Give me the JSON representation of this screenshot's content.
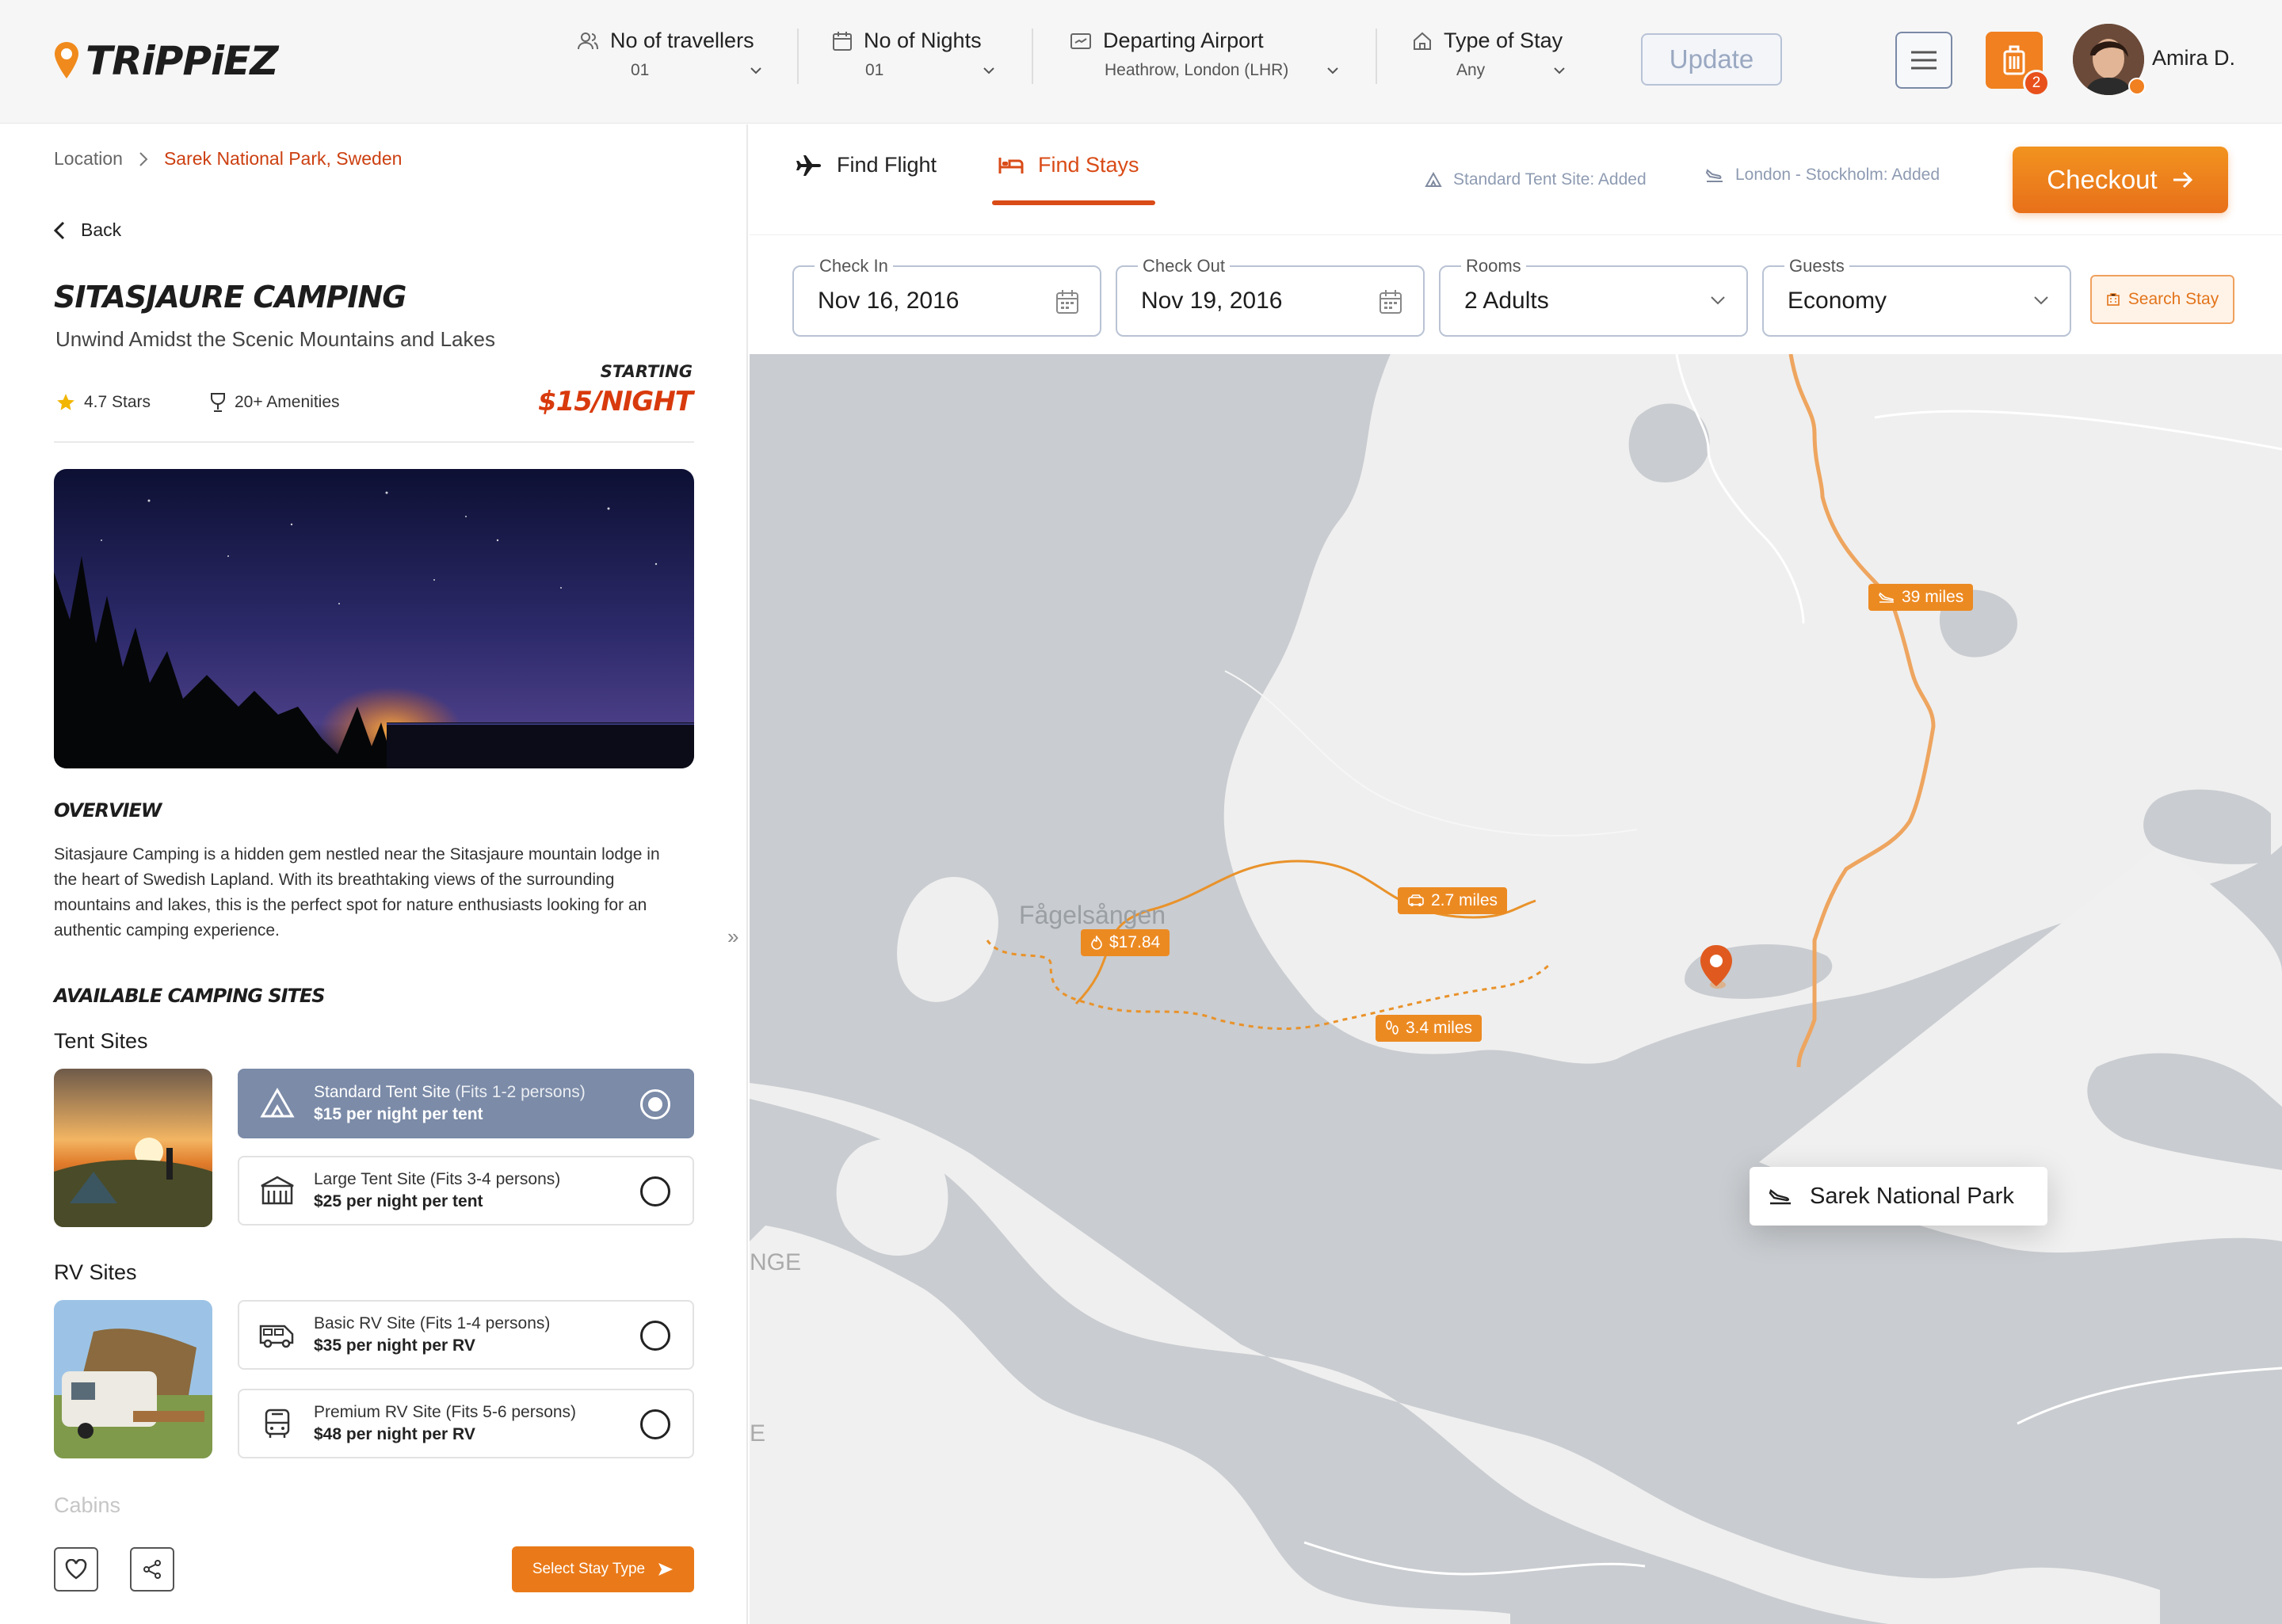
{
  "brand": {
    "logo_text": "TRiPPiEZ"
  },
  "topbar": {
    "travellers": {
      "label": "No of travellers",
      "value": "01"
    },
    "nights": {
      "label": "No of Nights",
      "value": "01"
    },
    "airport": {
      "label": "Departing Airport",
      "value": "Heathrow, London (LHR)"
    },
    "stay_type": {
      "label": "Type of Stay",
      "value": "Any"
    },
    "update_label": "Update",
    "cart_count": "2",
    "user_name": "Amira D."
  },
  "breadcrumb": {
    "root": "Location",
    "current": "Sarek National Park, Sweden"
  },
  "back_label": "Back",
  "listing": {
    "title": "SITASJAURE CAMPING",
    "subtitle": "Unwind Amidst the Scenic Mountains and Lakes",
    "rating": "4.7 Stars",
    "amenities": "20+ Amenities",
    "starting_label": "STARTING",
    "price": "$15/NIGHT",
    "overview_heading": "OVERVIEW",
    "overview_text": "Sitasjaure Camping is a hidden gem nestled near the Sitasjaure mountain lodge in the heart of Swedish Lapland. With its breathtaking views of the surrounding mountains and lakes, this is the perfect spot for nature enthusiasts looking for an authentic camping experience.",
    "sites_heading": "AVAILABLE CAMPING SITES"
  },
  "tent_sites": {
    "heading": "Tent Sites",
    "items": [
      {
        "name": "Standard Tent Site",
        "fits": " (Fits 1-2 persons)",
        "price": "$15 per night per tent",
        "selected": true
      },
      {
        "name": "Large Tent Site",
        "fits": " (Fits 3-4 persons)",
        "price": "$25 per night per tent",
        "selected": false
      }
    ]
  },
  "rv_sites": {
    "heading": "RV Sites",
    "items": [
      {
        "name": "Basic RV Site",
        "fits": " (Fits 1-4 persons)",
        "price": "$35 per night per RV",
        "selected": false
      },
      {
        "name": "Premium RV Site",
        "fits": " (Fits 5-6 persons)",
        "price": "$48 per night per RV",
        "selected": false
      }
    ]
  },
  "cabins_heading": "Cabins",
  "select_stay_label": "Select Stay Type",
  "tabs": {
    "flight": "Find Flight",
    "stays": "Find Stays",
    "active": "stays"
  },
  "added": {
    "tent": "Standard Tent Site:",
    "tent_status": " Added",
    "flight": "London - Stockholm:",
    "flight_status": " Added"
  },
  "checkout_label": "Checkout",
  "search": {
    "check_in": {
      "label": "Check In",
      "value": "Nov 16, 2016"
    },
    "check_out": {
      "label": "Check Out",
      "value": "Nov 19, 2016"
    },
    "rooms": {
      "label": "Rooms",
      "value": "2 Adults"
    },
    "guests": {
      "label": "Guests",
      "value": "Economy"
    },
    "button": "Search Stay"
  },
  "map": {
    "town_label": "Fågelsången",
    "place_name": "Sarek National Park",
    "pills": {
      "price": "$17.84",
      "drive": "2.7 miles",
      "walk": "3.4 miles",
      "flight": "39 miles"
    },
    "edge_label_1": "NGE",
    "edge_label_2": "E"
  },
  "colors": {
    "accent": "#ea7a19",
    "accent_dark": "#d94b17",
    "selected_site": "#7b8ba8"
  }
}
